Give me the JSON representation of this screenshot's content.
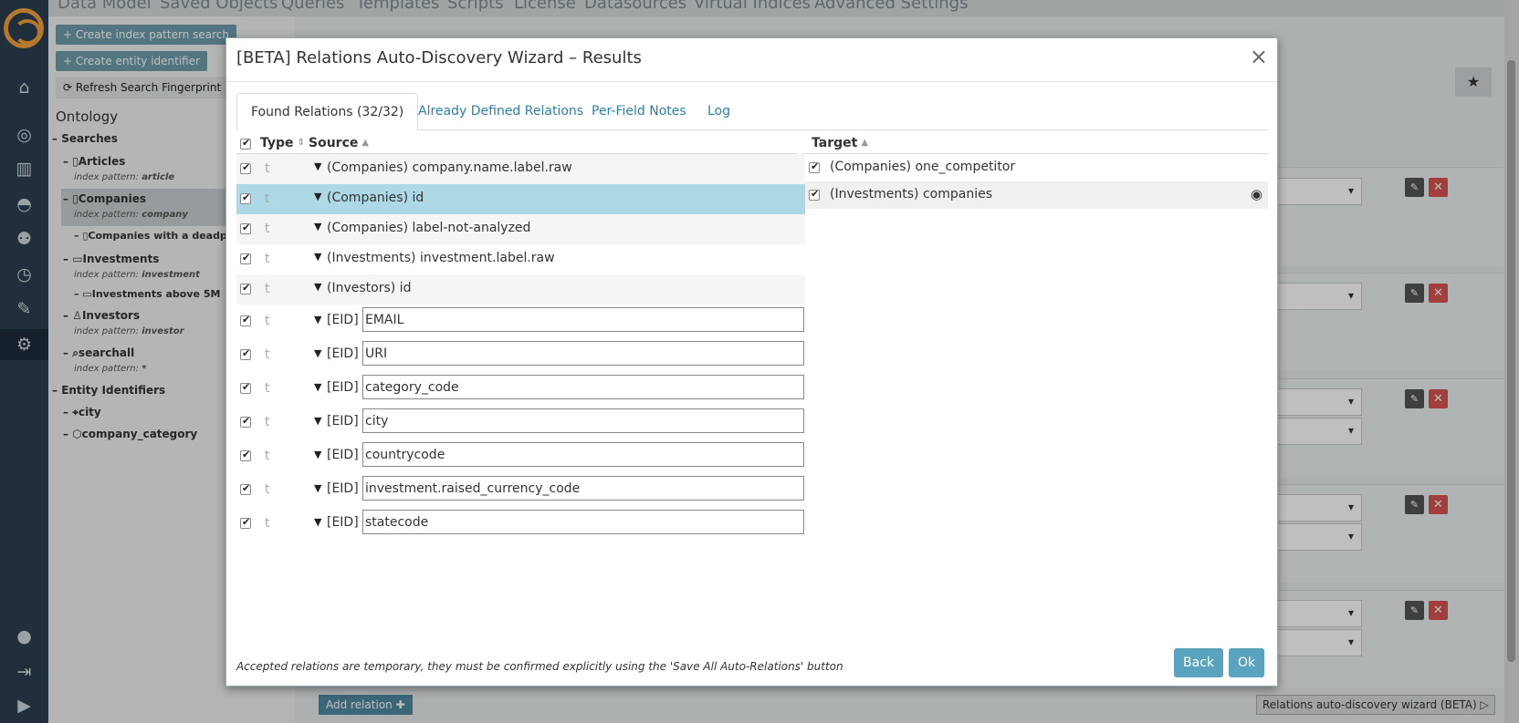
{
  "background": {
    "topnav": [
      "Data Model",
      "Saved Objects",
      "Queries",
      "Templates",
      "Scripts",
      "License",
      "Datasources",
      "Virtual Indices",
      "Advanced Settings"
    ],
    "buttons": {
      "create_index_pattern_search": "+ Create index pattern search",
      "create_entity_identifier": "+ Create entity identifier",
      "refresh_fingerprint": "Refresh Search Fingerprint"
    },
    "tree": {
      "title": "Ontology",
      "searches_label": "Searches",
      "articles": "Articles",
      "articles_pattern": "article",
      "companies": "Companies",
      "companies_pattern": "company",
      "companies_deadpool": "Companies with a deadpoo",
      "investments": "Investments",
      "investments_pattern": "investment",
      "investments_5m": "Investments above 5M",
      "investors": "Investors",
      "investors_pattern": "investor",
      "searchall": "searchall",
      "searchall_pattern": "*",
      "index_pattern_prefix": "index pattern: ",
      "entity_identifiers_label": "Entity Identifiers",
      "city": "city",
      "company_category": "company_category"
    },
    "add_relation": "Add relation",
    "wizard_button": "Relations auto-discovery wizard (BETA)"
  },
  "modal": {
    "title": "[BETA] Relations Auto-Discovery Wizard – Results",
    "close": "×",
    "tabs": [
      {
        "label": "Found Relations (32/32)"
      },
      {
        "label": "Already Defined Relations"
      },
      {
        "label": "Per-Field Notes"
      },
      {
        "label": "Log"
      }
    ],
    "columns": {
      "type": "Type",
      "source": "Source",
      "target": "Target"
    },
    "source_rows": [
      {
        "type": "t",
        "text": "(Companies) company.name.label.raw"
      },
      {
        "type": "t",
        "text": "(Companies) id"
      },
      {
        "type": "t",
        "text": "(Companies) label-not-analyzed"
      },
      {
        "type": "t",
        "text": "(Investments) investment.label.raw"
      },
      {
        "type": "t",
        "text": "(Investors) id"
      },
      {
        "type": "t",
        "prefix": "[EID]",
        "value": "EMAIL"
      },
      {
        "type": "t",
        "prefix": "[EID]",
        "value": "URI"
      },
      {
        "type": "t",
        "prefix": "[EID]",
        "value": "category_code"
      },
      {
        "type": "t",
        "prefix": "[EID]",
        "value": "city"
      },
      {
        "type": "t",
        "prefix": "[EID]",
        "value": "countrycode"
      },
      {
        "type": "t",
        "prefix": "[EID]",
        "value": "investment.raised_currency_code"
      },
      {
        "type": "t",
        "prefix": "[EID]",
        "value": "statecode"
      }
    ],
    "target_rows": [
      {
        "text": "(Companies) one_competitor"
      },
      {
        "text": "(Investments) companies"
      }
    ],
    "footer_note": "Accepted relations are temporary, they must be confirmed explicitly using the 'Save All Auto-Relations' button",
    "back_button": "Back",
    "ok_button": "Ok"
  }
}
